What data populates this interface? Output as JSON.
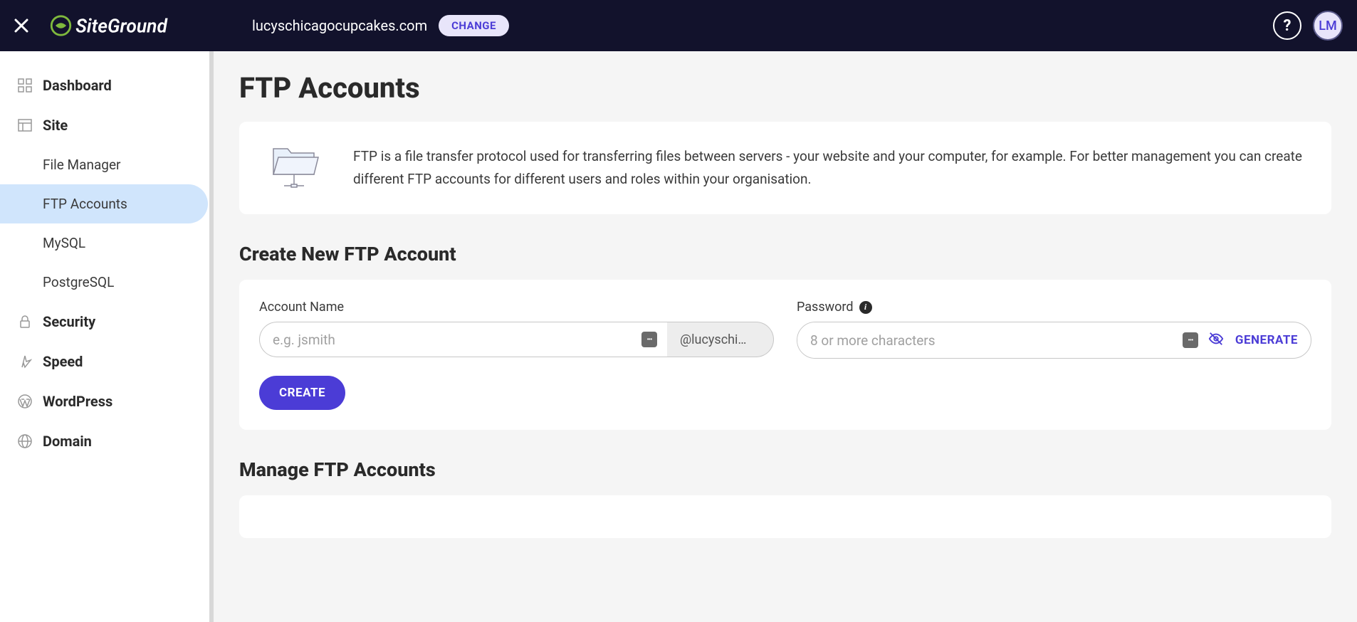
{
  "header": {
    "domain": "lucyschicagocupcakes.com",
    "change_label": "CHANGE",
    "avatar_initials": "LM"
  },
  "sidebar": {
    "items": [
      {
        "label": "Dashboard"
      },
      {
        "label": "Site"
      },
      {
        "label": "Security"
      },
      {
        "label": "Speed"
      },
      {
        "label": "WordPress"
      },
      {
        "label": "Domain"
      }
    ],
    "site_subitems": [
      {
        "label": "File Manager"
      },
      {
        "label": "FTP Accounts"
      },
      {
        "label": "MySQL"
      },
      {
        "label": "PostgreSQL"
      }
    ]
  },
  "page": {
    "title": "FTP Accounts",
    "info_text": "FTP is a file transfer protocol used for transferring files between servers - your website and your computer, for example. For better management you can create different FTP accounts for different users and roles within your organisation.",
    "create_section_title": "Create New FTP Account",
    "manage_section_title": "Manage FTP Accounts",
    "form": {
      "account_label": "Account Name",
      "account_placeholder": "e.g. jsmith",
      "account_suffix": "@lucyschi…",
      "password_label": "Password",
      "password_placeholder": "8 or more characters",
      "generate_label": "GENERATE",
      "create_label": "CREATE"
    }
  }
}
